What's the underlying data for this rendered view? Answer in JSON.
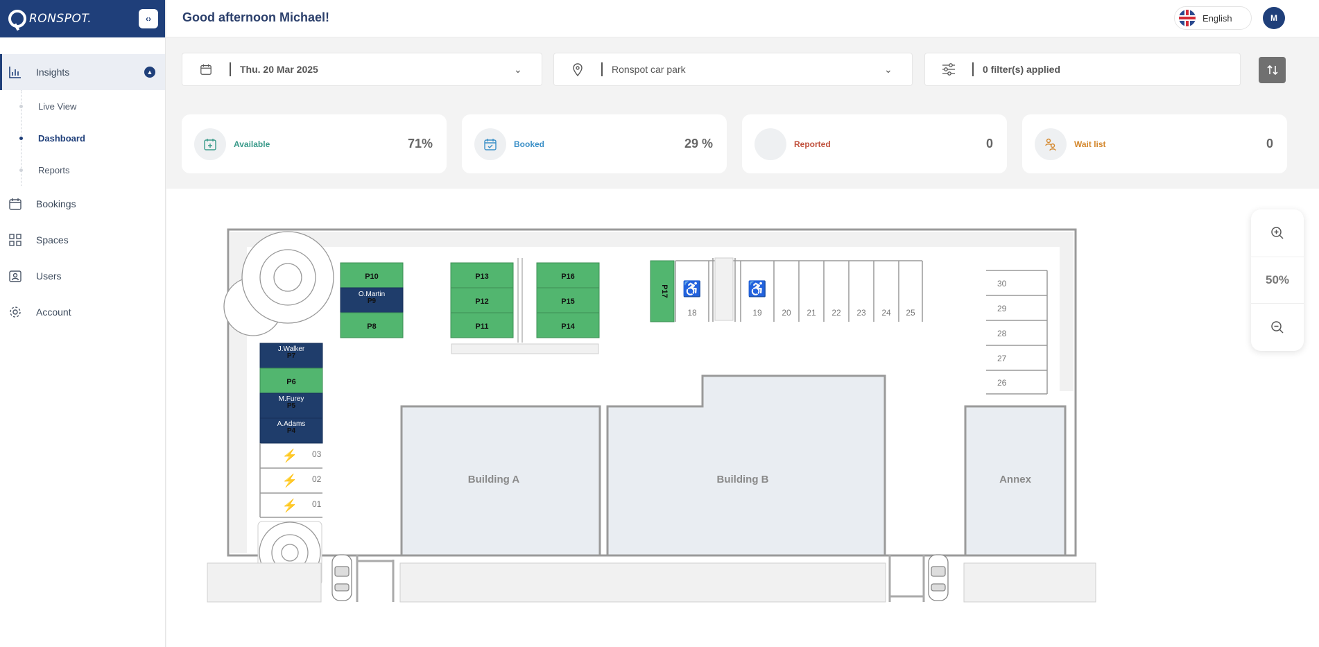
{
  "app": {
    "brand": "RONSPOT."
  },
  "header": {
    "greeting": "Good afternoon Michael!",
    "language": "English",
    "avatar_initial": "M"
  },
  "sidebar": {
    "items": [
      {
        "label": "Insights",
        "icon": "chart-icon",
        "active": true
      },
      {
        "label": "Bookings",
        "icon": "calendar-icon"
      },
      {
        "label": "Spaces",
        "icon": "grid-icon"
      },
      {
        "label": "Users",
        "icon": "user-badge-icon"
      },
      {
        "label": "Account",
        "icon": "gear-icon"
      }
    ],
    "subitems": [
      {
        "label": "Live View"
      },
      {
        "label": "Dashboard",
        "active": true
      },
      {
        "label": "Reports"
      }
    ]
  },
  "filters": {
    "date": "Thu. 20 Mar 2025",
    "location": "Ronspot car park",
    "filters_applied": "0 filter(s) applied"
  },
  "stats": [
    {
      "label": "Available",
      "value": "71%",
      "color": "#3a9a8a"
    },
    {
      "label": "Booked",
      "value": "29 %",
      "color": "#3a8fc7"
    },
    {
      "label": "Reported",
      "value": "0",
      "color": "#c0503c"
    },
    {
      "label": "Wait list",
      "value": "0",
      "color": "#d4882e"
    }
  ],
  "zoom": {
    "level": "50%"
  },
  "map": {
    "colors": {
      "available": "#52b66f",
      "booked": "#1f3d6b",
      "wall": "#9a9a9a",
      "building": "#e9edf2"
    },
    "top_row_spaces": [
      {
        "id": "P10",
        "status": "available"
      },
      {
        "id": "P9",
        "status": "booked",
        "user": "O.Martin"
      },
      {
        "id": "P8",
        "status": "available"
      },
      {
        "id": "P13",
        "status": "available"
      },
      {
        "id": "P12",
        "status": "available"
      },
      {
        "id": "P11",
        "status": "available"
      },
      {
        "id": "P16",
        "status": "available"
      },
      {
        "id": "P15",
        "status": "available"
      },
      {
        "id": "P14",
        "status": "available"
      },
      {
        "id": "P17",
        "status": "available"
      }
    ],
    "left_column_spaces": [
      {
        "id": "P7",
        "status": "booked",
        "user": "J.Walker"
      },
      {
        "id": "P6",
        "status": "available"
      },
      {
        "id": "P5",
        "status": "booked",
        "user": "M.Furey"
      },
      {
        "id": "P4",
        "status": "booked",
        "user": "A.Adams"
      }
    ],
    "ev_spaces": [
      "03",
      "02",
      "01"
    ],
    "numbered_spaces": [
      "18",
      "19",
      "20",
      "21",
      "22",
      "23",
      "24",
      "25"
    ],
    "right_spaces": [
      "30",
      "29",
      "28",
      "27",
      "26"
    ],
    "buildings": [
      "Building A",
      "Building B",
      "Annex"
    ]
  }
}
